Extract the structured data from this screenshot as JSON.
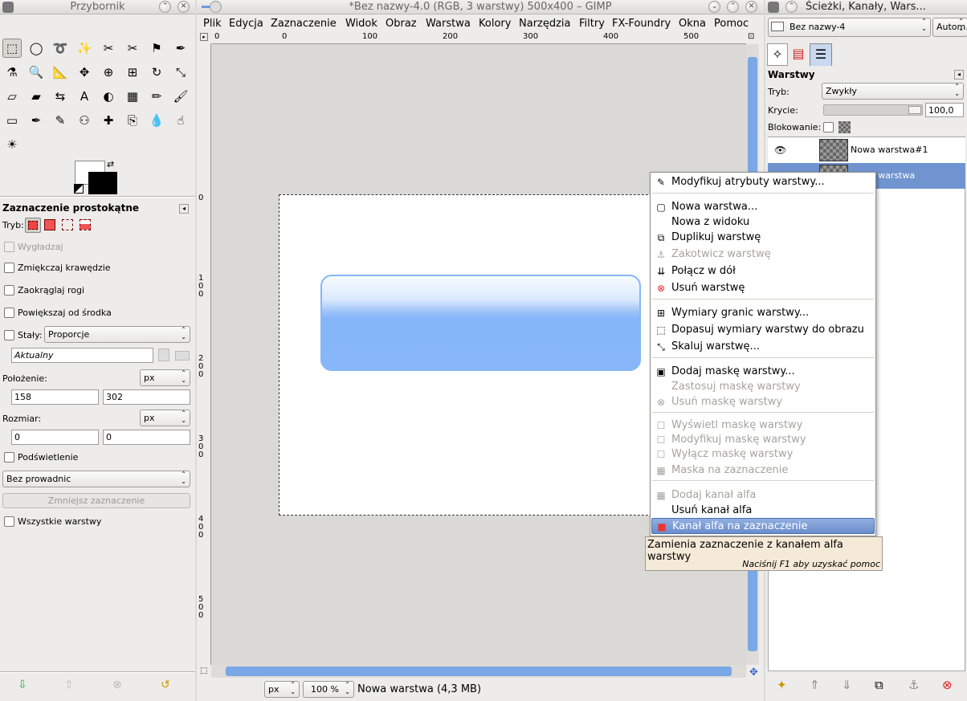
{
  "toolbox": {
    "title": "Przybornik",
    "tools": [
      "rect-select",
      "ellipse-select",
      "free-select",
      "fuzzy-select",
      "select-by-color",
      "scissors-select",
      "foreground-select",
      "paths",
      "color-picker",
      "zoom",
      "measure",
      "move",
      "align",
      "crop",
      "rotate",
      "scale",
      "shear",
      "perspective",
      "flip",
      "text",
      "bucket-fill",
      "blend",
      "pencil",
      "paintbrush",
      "eraser",
      "airbrush",
      "ink",
      "clone",
      "heal",
      "perspective-clone",
      "blur",
      "smudge",
      "dodge-burn"
    ],
    "options_title": "Zaznaczenie prostokątne",
    "mode_label": "Tryb:",
    "antialias": "Wygładzaj",
    "feather": "Zmiękczaj krawędzie",
    "rounded": "Zaokrąglaj rogi",
    "expand": "Powiększaj od środka",
    "fixed": "Stały:",
    "fixed_value": "Proporcje",
    "current": "Aktualny",
    "position_label": "Położenie:",
    "position_unit": "px",
    "pos_x": "158",
    "pos_y": "302",
    "size_label": "Rozmiar:",
    "size_unit": "px",
    "size_w": "0",
    "size_h": "0",
    "highlight": "Podświetlenie",
    "guides": "Bez prowadnic",
    "shrink": "Zmniejsz zaznaczenie",
    "all_layers": "Wszystkie warstwy"
  },
  "image_window": {
    "title": "*Bez nazwy-4.0 (RGB, 3 warstwy) 500x400 – GIMP",
    "menu": [
      "Plik",
      "Edycja",
      "Zaznaczenie",
      "Widok",
      "Obraz",
      "Warstwa",
      "Kolory",
      "Narzędzia",
      "Filtry",
      "FX-Foundry",
      "Okna",
      "Pomoc"
    ],
    "ruler_h": [
      "0",
      "0",
      "100",
      "200",
      "300",
      "400",
      "500"
    ],
    "ruler_v": [
      "0",
      "1 0 0",
      "2 0 0",
      "3 0 0",
      "4 0 0",
      "5 0 0"
    ],
    "unit": "px",
    "zoom": "100 %",
    "status": "Nowa warstwa (4,3 MB)"
  },
  "docks": {
    "title": "Ścieżki, Kanały, Wars...",
    "image_combo": "Bez nazwy-4",
    "auto": "Autom.",
    "layers_title": "Warstwy",
    "mode_label": "Tryb:",
    "mode_value": "Zwykły",
    "opacity_label": "Krycie:",
    "opacity_value": "100,0",
    "lock_label": "Blokowanie:",
    "layers": [
      "Nowa warstwa#1",
      "Nowa warstwa"
    ]
  },
  "context_menu": {
    "items": [
      {
        "label": "Modyfikuj atrybuty warstwy...",
        "icon": "✎",
        "state": "normal"
      },
      {
        "label": "Nowa warstwa...",
        "icon": "▢",
        "state": "normal"
      },
      {
        "label": "Nowa z widoku",
        "icon": "",
        "state": "normal"
      },
      {
        "label": "Duplikuj warstwę",
        "icon": "⧉",
        "state": "normal"
      },
      {
        "label": "Zakotwicz warstwę",
        "icon": "⚓",
        "state": "disabled"
      },
      {
        "label": "Połącz w dół",
        "icon": "⇊",
        "state": "normal"
      },
      {
        "label": "Usuń warstwę",
        "icon": "⊗",
        "state": "normal"
      },
      {
        "label": "Wymiary granic warstwy...",
        "icon": "⊞",
        "state": "normal"
      },
      {
        "label": "Dopasuj wymiary warstwy do obrazu",
        "icon": "⬚",
        "state": "normal"
      },
      {
        "label": "Skaluj warstwę...",
        "icon": "⤡",
        "state": "normal"
      },
      {
        "label": "Dodaj maskę warstwy...",
        "icon": "▣",
        "state": "normal"
      },
      {
        "label": "Zastosuj maskę warstwy",
        "icon": "",
        "state": "disabled"
      },
      {
        "label": "Usuń maskę warstwy",
        "icon": "⊗",
        "state": "disabled"
      },
      {
        "label": "Wyświetl maskę warstwy",
        "icon": "☐",
        "state": "disabled"
      },
      {
        "label": "Modyfikuj maskę warstwy",
        "icon": "☐",
        "state": "disabled"
      },
      {
        "label": "Wyłącz maskę warstwy",
        "icon": "☐",
        "state": "disabled"
      },
      {
        "label": "Maska na zaznaczenie",
        "icon": "▦",
        "state": "disabled"
      },
      {
        "label": "Dodaj kanał alfa",
        "icon": "▦",
        "state": "disabled"
      },
      {
        "label": "Usuń kanał alfa",
        "icon": "",
        "state": "normal"
      },
      {
        "label": "Kanał alfa na zaznaczenie",
        "icon": "■",
        "state": "highlighted"
      }
    ]
  },
  "tooltip": {
    "text": "Zamienia zaznaczenie z kanałem alfa warstwy",
    "help": "Naciśnij F1 aby uzyskać pomoc"
  }
}
